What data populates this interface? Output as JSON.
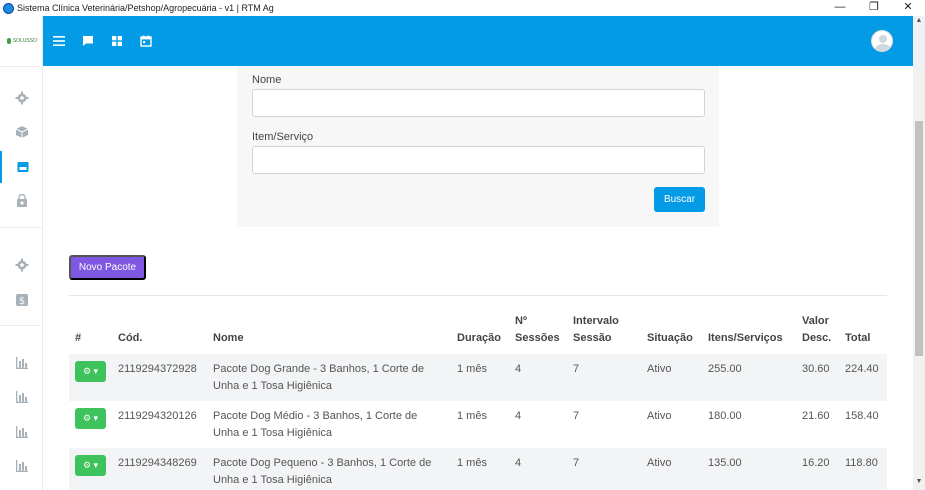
{
  "window": {
    "title": "Sistema Clínica Veterinária/Petshop/Agropecuária - v1 | RTM Ag",
    "minimize": "—",
    "restore": "❐",
    "close": "✕"
  },
  "sidebar": {
    "logo_text": "SOLUSSO",
    "items": [
      {
        "icon": "gear-icon"
      },
      {
        "icon": "box-icon"
      },
      {
        "icon": "store-icon",
        "active": true
      },
      {
        "icon": "bag-icon"
      },
      {
        "icon": "gear-icon"
      },
      {
        "icon": "dollar-icon"
      },
      {
        "icon": "bar-chart-icon"
      },
      {
        "icon": "bar-chart-icon"
      },
      {
        "icon": "bar-chart-icon"
      },
      {
        "icon": "bar-chart-icon"
      }
    ]
  },
  "topbar": {
    "icons": [
      "menu-icon",
      "chat-icon",
      "grid-icon",
      "calendar-icon"
    ],
    "accent": "#039be5"
  },
  "filter": {
    "nome_label": "Nome",
    "nome_value": "",
    "item_label": "Item/Serviço",
    "item_value": "",
    "search_button": "Buscar"
  },
  "actions": {
    "new_package": "Novo Pacote"
  },
  "table": {
    "headers": [
      [
        "#"
      ],
      [
        "Cód."
      ],
      [
        "Nome"
      ],
      [
        "Duração"
      ],
      [
        "Nº",
        "Sessões"
      ],
      [
        "Intervalo",
        "Sessão"
      ],
      [
        "Situação"
      ],
      [
        "Itens/Serviços"
      ],
      [
        "Valor",
        "Desc."
      ],
      [
        "Total"
      ]
    ],
    "rows": [
      {
        "code": "2119294372928",
        "name": "Pacote Dog Grande - 3 Banhos, 1 Corte de Unha e 1 Tosa Higiênica",
        "duration": "1 mês",
        "sessions": "4",
        "interval": "7",
        "status": "Ativo",
        "items": "255.00",
        "discount": "30.60",
        "total": "224.40"
      },
      {
        "code": "2119294320126",
        "name": "Pacote Dog Médio - 3 Banhos, 1 Corte de Unha e 1 Tosa Higiênica",
        "duration": "1 mês",
        "sessions": "4",
        "interval": "7",
        "status": "Ativo",
        "items": "180.00",
        "discount": "21.60",
        "total": "158.40"
      },
      {
        "code": "2119294348269",
        "name": "Pacote Dog Pequeno - 3 Banhos, 1 Corte de Unha e 1 Tosa Higiênica",
        "duration": "1 mês",
        "sessions": "4",
        "interval": "7",
        "status": "Ativo",
        "items": "135.00",
        "discount": "16.20",
        "total": "118.80"
      }
    ]
  },
  "colors": {
    "header": "#039be5",
    "new_button": "#7e57e2",
    "action_button": "#3ec25c"
  }
}
